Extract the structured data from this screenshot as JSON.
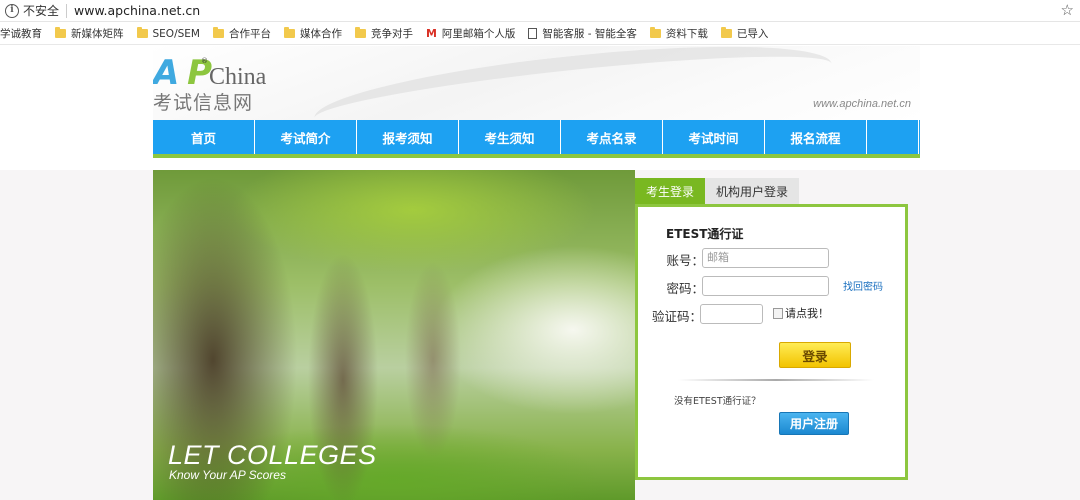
{
  "browser": {
    "security_label": "不安全",
    "url": "www.apchina.net.cn",
    "bookmarks": [
      {
        "icon": "none",
        "label": "学诚教育"
      },
      {
        "icon": "folder-icon",
        "label": "新媒体矩阵"
      },
      {
        "icon": "folder-icon",
        "label": "SEO/SEM"
      },
      {
        "icon": "folder-icon",
        "label": "合作平台"
      },
      {
        "icon": "folder-icon",
        "label": "媒体合作"
      },
      {
        "icon": "folder-icon",
        "label": "竞争对手"
      },
      {
        "icon": "gmail-icon",
        "label": "阿里邮箱个人版"
      },
      {
        "icon": "page-icon",
        "label": "智能客服 - 智能全客"
      },
      {
        "icon": "folder-icon",
        "label": "资料下载"
      },
      {
        "icon": "folder-icon",
        "label": "已导入"
      }
    ]
  },
  "header": {
    "logo_ap": "AP",
    "logo_reg": "®",
    "logo_china": "China",
    "logo_cn": "考试信息网",
    "site_url": "www.apchina.net.cn"
  },
  "nav": {
    "items": [
      "首页",
      "考试简介",
      "报考须知",
      "考生须知",
      "考点名录",
      "考试时间",
      "报名流程"
    ]
  },
  "hero": {
    "headline": "LET COLLEGES",
    "subline": "Know Your AP Scores"
  },
  "login": {
    "tabs": [
      "考生登录",
      "机构用户登录"
    ],
    "panel_title": "ETEST通行证",
    "account_label": "账号：",
    "account_placeholder": "邮箱",
    "password_label": "密码：",
    "forgot_link": "找回密码",
    "captcha_label": "验证码：",
    "captcha_image_alt": "请点我！",
    "login_button": "登录",
    "no_account_text": "没有ETEST通行证？",
    "register_button": "用户注册"
  },
  "colors": {
    "nav_blue": "#1da1f2",
    "accent_green": "#8dc63f",
    "login_yellow": "#f2c300",
    "register_blue": "#1b88d0"
  }
}
